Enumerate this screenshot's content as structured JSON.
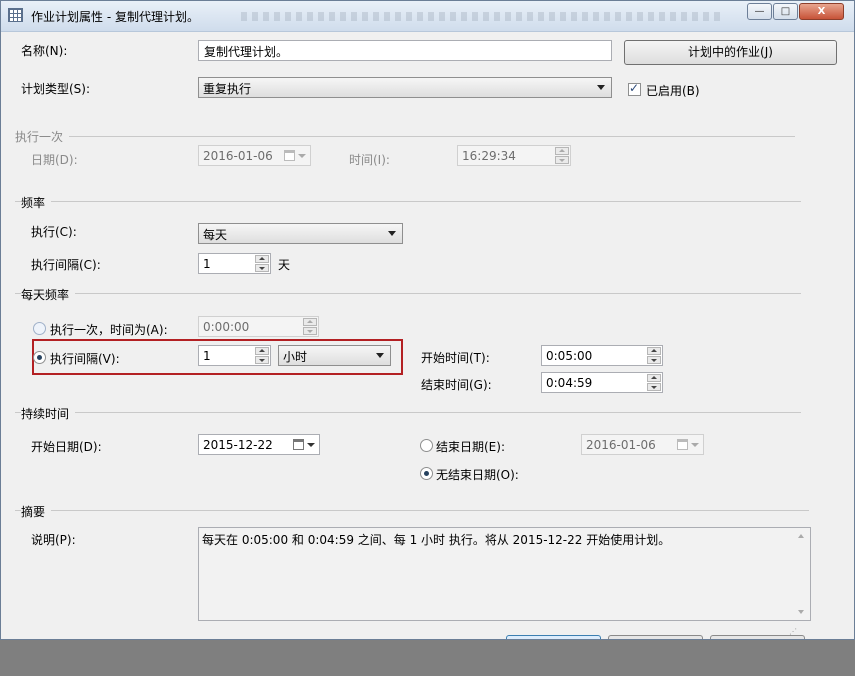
{
  "window": {
    "title": "作业计划属性 - 复制代理计划。",
    "min_glyph": "—",
    "max_glyph": "□",
    "close_glyph": "X"
  },
  "general": {
    "name_label": "名称(N):",
    "name_value": "复制代理计划。",
    "jobs_button": "计划中的作业(J)",
    "type_label": "计划类型(S):",
    "type_value": "重复执行",
    "enabled_label": "已启用(B)",
    "enabled_checked": true
  },
  "once": {
    "group_label": "执行一次",
    "date_label": "日期(D):",
    "date_value": "2016-01-06",
    "time_label": "时间(I):",
    "time_value": "16:29:34"
  },
  "frequency": {
    "group_label": "频率",
    "occurs_label": "执行(C):",
    "occurs_value": "每天",
    "recur_label": "执行间隔(C):",
    "recur_value": "1",
    "recur_unit": "天"
  },
  "daily": {
    "group_label": "每天频率",
    "once_label": "执行一次，时间为(A):",
    "once_time": "0:00:00",
    "every_label": "执行间隔(V):",
    "every_value": "1",
    "every_unit": "小时",
    "start_label": "开始时间(T):",
    "start_value": "0:05:00",
    "end_label": "结束时间(G):",
    "end_value": "0:04:59"
  },
  "duration": {
    "group_label": "持续时间",
    "start_label": "开始日期(D):",
    "start_value": "2015-12-22",
    "end_label": "结束日期(E):",
    "end_value": "2016-01-06",
    "noend_label": "无结束日期(O):"
  },
  "summary": {
    "group_label": "摘要",
    "desc_label": "说明(P):",
    "desc_value": "每天在 0:05:00 和 0:04:59 之间、每 1 小时 执行。将从 2015-12-22 开始使用计划。"
  },
  "colors": {
    "highlight_border": "#b32023",
    "window_bg": "#f0f0f0",
    "outside_bg": "#7f7f7f"
  }
}
